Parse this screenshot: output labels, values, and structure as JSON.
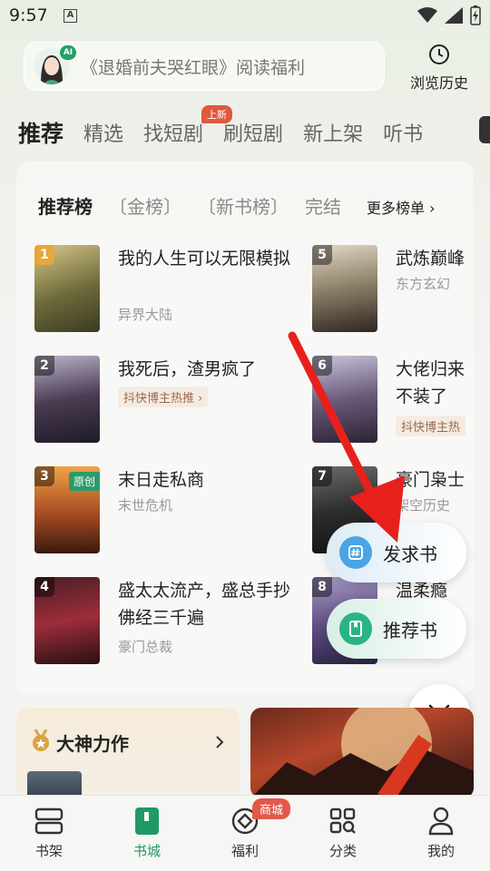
{
  "status": {
    "time": "9:57",
    "a_badge": "A"
  },
  "search": {
    "placeholder": "《退婚前夫哭红眼》阅读福利",
    "ai_badge": "AI"
  },
  "history": {
    "label": "浏览历史"
  },
  "tabs": [
    {
      "label": "推荐"
    },
    {
      "label": "精选"
    },
    {
      "label": "找短剧"
    },
    {
      "label": "刷短剧"
    },
    {
      "label": "新上架"
    },
    {
      "label": "听书"
    }
  ],
  "new_badge": "上新",
  "rank": {
    "title": "推荐榜",
    "tabs": [
      "金榜",
      "新书榜",
      "完结"
    ],
    "more": "更多榜单",
    "books": [
      {
        "num": "1",
        "title": "我的人生可以无限模拟",
        "genre": "异界大陆"
      },
      {
        "num": "2",
        "title": "我死后，渣男疯了",
        "tag": "抖快博主热推"
      },
      {
        "num": "3",
        "title": "末日走私商",
        "genre": "末世危机",
        "orig": "原创"
      },
      {
        "num": "4",
        "title": "盛太太流产，盛总手抄佛经三千遍",
        "genre": "豪门总裁"
      },
      {
        "num": "5",
        "title": "武炼巅峰",
        "genre": "东方玄幻"
      },
      {
        "num": "6",
        "title": "大佬归来不装了",
        "tag": "抖快博主热"
      },
      {
        "num": "7",
        "title": "豪门枭士",
        "genre": "架空历史"
      },
      {
        "num": "8",
        "title": "温柔瘾"
      }
    ]
  },
  "float": {
    "request": "发求书",
    "recommend": "推荐书"
  },
  "god": {
    "title": "大神力作"
  },
  "nav": [
    {
      "label": "书架"
    },
    {
      "label": "书城"
    },
    {
      "label": "福利"
    },
    {
      "label": "分类"
    },
    {
      "label": "我的"
    }
  ],
  "mall_badge": "商城",
  "colors": {
    "accent": "#1f9a66",
    "red": "#e2594a",
    "arrow": "#e8201c"
  }
}
